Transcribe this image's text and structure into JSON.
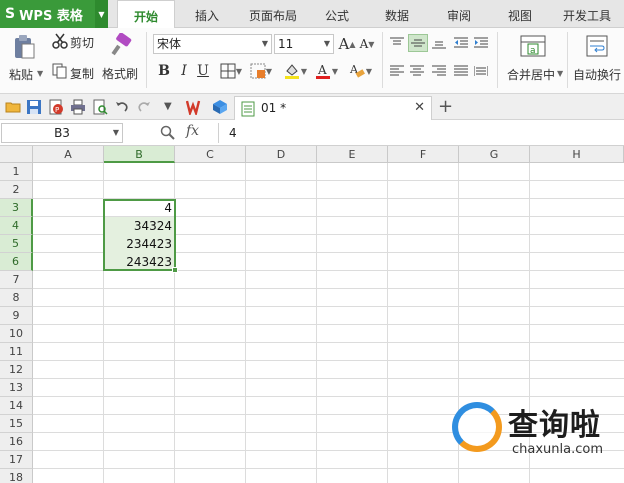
{
  "app": {
    "logo": "S",
    "name": "WPS 表格"
  },
  "tabs": [
    "开始",
    "插入",
    "页面布局",
    "公式",
    "数据",
    "审阅",
    "视图",
    "开发工具"
  ],
  "ribbon": {
    "clipboard": {
      "paste": "粘贴",
      "cut": "剪切",
      "copy": "复制",
      "format_painter": "格式刷"
    },
    "font": {
      "name": "宋体",
      "size": "11",
      "bold": "B",
      "italic": "I",
      "underline": "U",
      "grow": "A",
      "shrink": "A"
    },
    "merge_center": "合并居中",
    "wrap_text": "自动换行"
  },
  "document": {
    "tab_title": "01 *"
  },
  "formula_bar": {
    "cell_ref": "B3",
    "fx": "fx",
    "value": "4"
  },
  "sheet": {
    "columns": [
      "A",
      "B",
      "C",
      "D",
      "E",
      "F",
      "G",
      "H"
    ],
    "rows": [
      "1",
      "2",
      "3",
      "4",
      "5",
      "6",
      "7",
      "8",
      "9",
      "10",
      "11",
      "12",
      "13",
      "14",
      "15",
      "16",
      "17",
      "18"
    ],
    "selected_column": "B",
    "selected_rows": [
      "3",
      "4",
      "5",
      "6"
    ],
    "cells": [
      {
        "ref": "B3",
        "value": "4"
      },
      {
        "ref": "B4",
        "value": "34324"
      },
      {
        "ref": "B5",
        "value": "234423"
      },
      {
        "ref": "B6",
        "value": "243423"
      }
    ]
  },
  "watermark": {
    "title": "查询啦",
    "site": "chaxunla.com"
  },
  "colors": {
    "accent_green": "#3a9a3a",
    "selection_border": "#4e9a45",
    "selection_fill": "#e4f0df"
  }
}
